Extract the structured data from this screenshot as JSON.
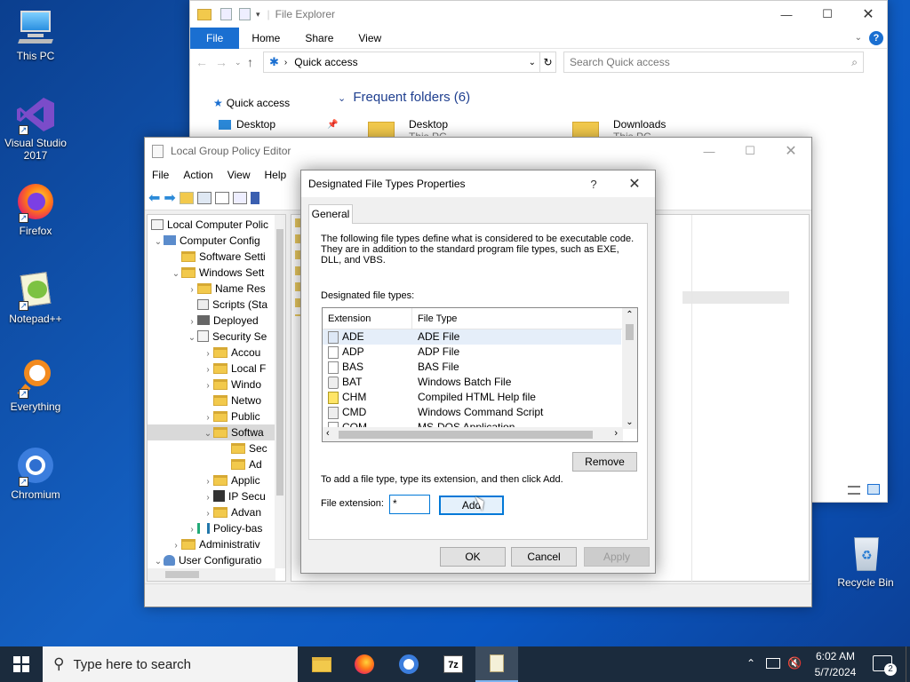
{
  "desktop": {
    "icons": [
      {
        "label": "This PC"
      },
      {
        "label": "Visual Studio 2017"
      },
      {
        "label": "Firefox"
      },
      {
        "label": "Notepad++"
      },
      {
        "label": "Everything"
      },
      {
        "label": "Chromium"
      },
      {
        "label": "Recycle Bin"
      }
    ]
  },
  "explorer": {
    "title": "File Explorer",
    "tabs": [
      "File",
      "Home",
      "Share",
      "View"
    ],
    "address": "Quick access",
    "search_placeholder": "Search Quick access",
    "nav_quick_access": "Quick access",
    "nav_desktop": "Desktop",
    "section": "Frequent folders (6)",
    "folders": [
      {
        "name": "Desktop",
        "sub": "This PC"
      },
      {
        "name": "Downloads",
        "sub": "This PC"
      }
    ]
  },
  "gpedit": {
    "title": "Local Group Policy Editor",
    "menu": [
      "File",
      "Action",
      "View",
      "Help"
    ],
    "tree": [
      "Local Computer Polic",
      "Computer Config",
      "Software Setti",
      "Windows Sett",
      "Name Res",
      "Scripts (Sta",
      "Deployed",
      "Security Se",
      "Accou",
      "Local F",
      "Windo",
      "Netwo",
      "Public",
      "Softwa",
      "Sec",
      "Ad",
      "Applic",
      "IP Secu",
      "Advan",
      "Policy-bas",
      "Administrativ",
      "User Configuratio"
    ]
  },
  "dialog": {
    "title": "Designated File Types Properties",
    "help": "?",
    "tab": "General",
    "description": "The following file types define what is considered to be executable code. They are in addition to the standard program file types, such as EXE, DLL, and VBS.",
    "list_label": "Designated file types:",
    "col_extension": "Extension",
    "col_type": "File Type",
    "rows": [
      {
        "ext": "ADE",
        "type": "ADE File"
      },
      {
        "ext": "ADP",
        "type": "ADP File"
      },
      {
        "ext": "BAS",
        "type": "BAS File"
      },
      {
        "ext": "BAT",
        "type": "Windows Batch File"
      },
      {
        "ext": "CHM",
        "type": "Compiled HTML Help file"
      },
      {
        "ext": "CMD",
        "type": "Windows Command Script"
      },
      {
        "ext": "COM",
        "type": "MS-DOS Application"
      }
    ],
    "remove": "Remove",
    "add_hint": "To add a file type, type its extension, and then click Add.",
    "ext_label": "File extension:",
    "ext_value": "*",
    "add": "Add",
    "ok": "OK",
    "cancel": "Cancel",
    "apply": "Apply"
  },
  "taskbar": {
    "search_placeholder": "Type here to search",
    "time": "6:02 AM",
    "date": "5/7/2024",
    "notifications": "2"
  }
}
